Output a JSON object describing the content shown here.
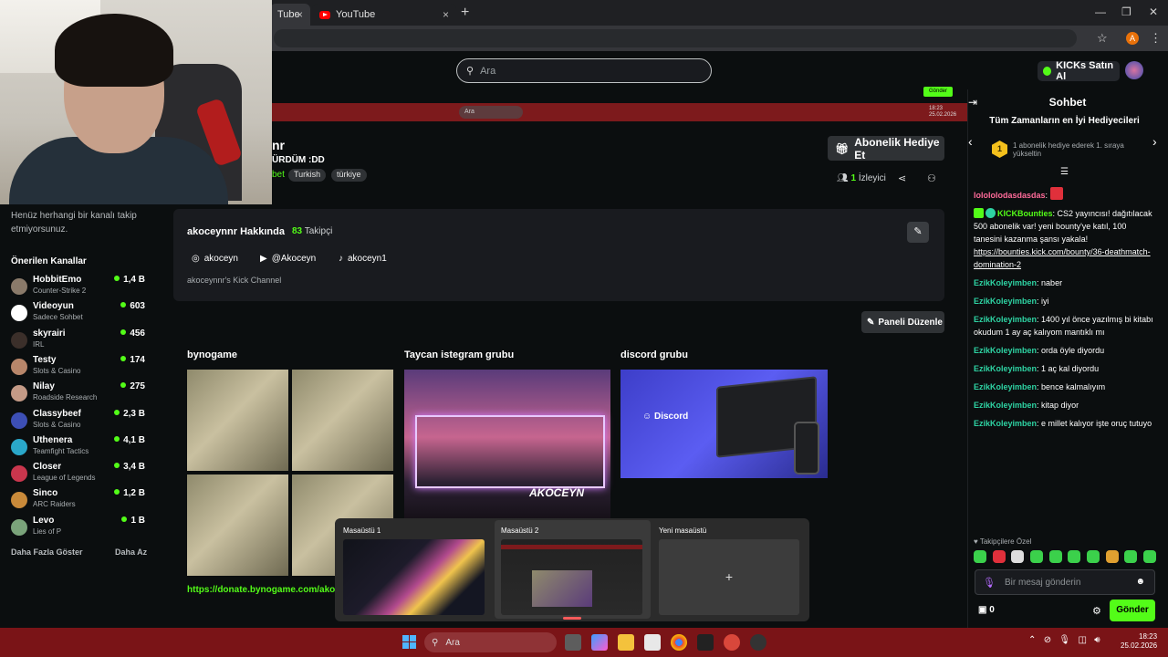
{
  "browser": {
    "tabs": [
      {
        "label": "Tube"
      },
      {
        "label": "YouTube"
      }
    ],
    "new_tab_icon": "plus-icon",
    "profile_letter": "A"
  },
  "kick_header": {
    "search_placeholder": "Ara",
    "kicks_button": "KICKs Satın Al"
  },
  "stream_overlay": {
    "gonder_label": "Gönder",
    "mini_search": "Ara",
    "mini_time": "18:23",
    "mini_date": "25.02.2026"
  },
  "sidebar": {
    "no_follow_text": "Henüz herhangi bir kanalı takip etmiyorsunuz.",
    "recommended_title": "Önerilen Kanallar",
    "channels": [
      {
        "name": "HobbitEmo",
        "category": "Counter-Strike 2",
        "viewers": "1,4 B",
        "color": "#8a7a6a"
      },
      {
        "name": "Videoyun",
        "category": "Sadece Sohbet",
        "viewers": "603",
        "color": "#ffffff"
      },
      {
        "name": "skyrairi",
        "category": "IRL",
        "viewers": "456",
        "color": "#3b2f2a"
      },
      {
        "name": "Testy",
        "category": "Slots & Casino",
        "viewers": "174",
        "color": "#b8866a"
      },
      {
        "name": "Nilay",
        "category": "Roadside Research",
        "viewers": "275",
        "color": "#c49a86"
      },
      {
        "name": "Classybeef",
        "category": "Slots & Casino",
        "viewers": "2,3 B",
        "color": "#3d4fb5"
      },
      {
        "name": "Uthenera",
        "category": "Teamfight Tactics",
        "viewers": "4,1 B",
        "color": "#2aa7c9"
      },
      {
        "name": "Closer",
        "category": "League of Legends",
        "viewers": "3,4 B",
        "color": "#c9364d"
      },
      {
        "name": "Sinco",
        "category": "ARC Raiders",
        "viewers": "1,2 B",
        "color": "#c98a3a"
      },
      {
        "name": "Levo",
        "category": "Lies of P",
        "viewers": "1 B",
        "color": "#7aa37a"
      }
    ],
    "show_more": "Daha Fazla Göster",
    "show_less": "Daha Az"
  },
  "channel": {
    "name_fragment": "nr",
    "title_fragment": "ÜRDÜM :DD",
    "category_fragment": "bet",
    "tags": [
      "Turkish",
      "türkiye"
    ],
    "sub_gift_button": "Abonelik Hediye Et",
    "viewer_count": "1",
    "viewer_label": "İzleyici"
  },
  "about": {
    "title": "akoceynnr Hakkında",
    "followers_count": "83",
    "followers_label": "Takipçi",
    "socials": [
      {
        "icon": "instagram-icon",
        "label": "akoceyn"
      },
      {
        "icon": "youtube-icon",
        "label": "@Akoceyn"
      },
      {
        "icon": "tiktok-icon",
        "label": "akoceyn1"
      }
    ],
    "description": "akoceynnr's Kick Channel"
  },
  "panels": {
    "edit_button": "Paneli Düzenle",
    "items": [
      {
        "title": "bynogame",
        "link": "https://donate.bynogame.com/akoceynnr"
      },
      {
        "title": "Taycan istegram grubu",
        "logo_text": "AKOCEYN"
      },
      {
        "title": "discord grubu",
        "image_text": "Discord"
      }
    ]
  },
  "desktop_switcher": {
    "desktops": [
      {
        "label": "Masaüstü 1"
      },
      {
        "label": "Masaüstü 2"
      }
    ],
    "new_desktop": "Yeni masaüstü"
  },
  "chat": {
    "title": "Sohbet",
    "top_gifters_title": "Tüm Zamanların en İyi Hediyecileri",
    "gift_rank": "1",
    "gift_text": "1 abonelik hediye ederek 1. sıraya yükseltin",
    "messages": [
      {
        "user": "lolololodasdasdas",
        "color": "#ff6b9a",
        "text": ""
      },
      {
        "user": "KICKBounties",
        "color": "#53fc18",
        "text": "CS2 yayıncısı! dağıtılacak 500 abonelik var! yeni bounty'ye katıl, 100 tanesini kazanma şansı yakala!",
        "link": "https://bounties.kick.com/bounty/36-deathmatch-domination-2"
      },
      {
        "user": "EzikKoleyimben",
        "color": "#2ed3a3",
        "text": "naber"
      },
      {
        "user": "EzikKoleyimben",
        "color": "#2ed3a3",
        "text": "iyi"
      },
      {
        "user": "EzikKoleyimben",
        "color": "#2ed3a3",
        "text": "1400 yıl önce yazılmış bi kitabı okudum 1 ay aç kalıyom mantıklı mı"
      },
      {
        "user": "EzikKoleyimben",
        "color": "#2ed3a3",
        "text": "orda öyle diyordu"
      },
      {
        "user": "EzikKoleyimben",
        "color": "#2ed3a3",
        "text": "1 aç kal diyordu"
      },
      {
        "user": "EzikKoleyimben",
        "color": "#2ed3a3",
        "text": "bence kalmalıyım"
      },
      {
        "user": "EzikKoleyimben",
        "color": "#2ed3a3",
        "text": "kitap diyor"
      },
      {
        "user": "EzikKoleyimben",
        "color": "#2ed3a3",
        "text": "e millet kalıyor işte oruç tutuyo"
      }
    ],
    "favorites_label": "Takipçilere Özel",
    "input_placeholder": "Bir mesaj gönderin",
    "points": "0",
    "send_button": "Gönder"
  },
  "taskbar": {
    "search_placeholder": "Ara",
    "time": "18:23",
    "date": "25.02.2026"
  },
  "colors": {
    "accent": "#53fc18",
    "taskbar": "#7a1417",
    "background": "#0b0e0f"
  }
}
